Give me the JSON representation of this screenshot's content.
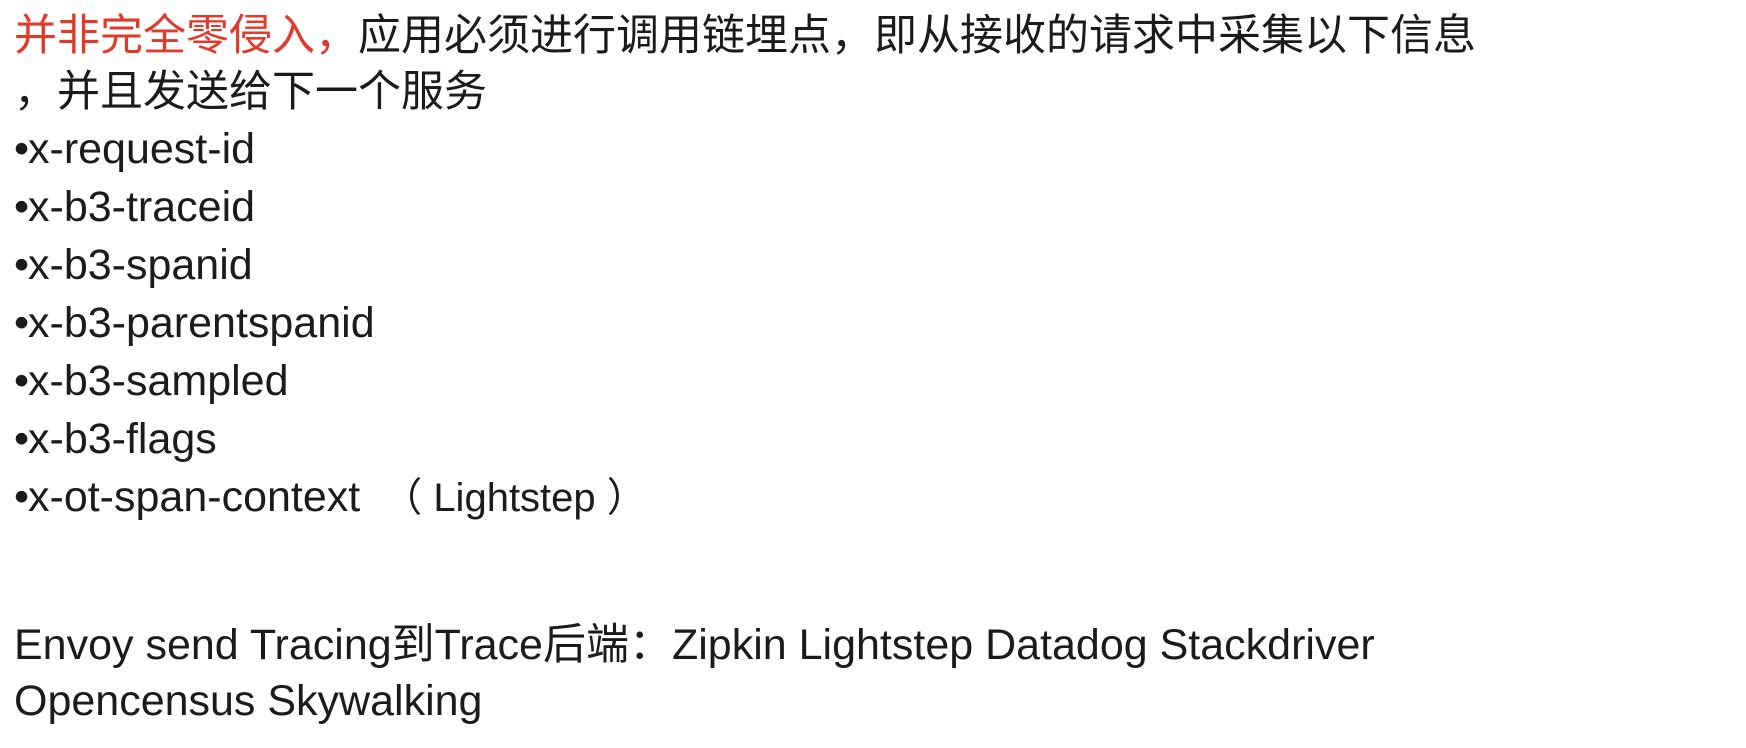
{
  "intro": {
    "highlight": "并非完全零侵入，",
    "line1_rest": "应用必须进行调用链埋点，即从接收的请求中采集以下信息",
    "line2": "，并且发送给下一个服务"
  },
  "bullet_symbol": "•",
  "bullets": [
    {
      "label": "x-request-id"
    },
    {
      "label": "x-b3-traceid"
    },
    {
      "label": "x-b3-spanid"
    },
    {
      "label": "x-b3-parentspanid"
    },
    {
      "label": "x-b3-sampled"
    },
    {
      "label": "x-b3-flags"
    },
    {
      "label": "x-ot-span-context",
      "note": "（ Lightstep ）"
    }
  ],
  "footer": {
    "line1": "Envoy send Tracing到Trace后端：Zipkin Lightstep Datadog Stackdriver",
    "line2": "Opencensus Skywalking"
  }
}
